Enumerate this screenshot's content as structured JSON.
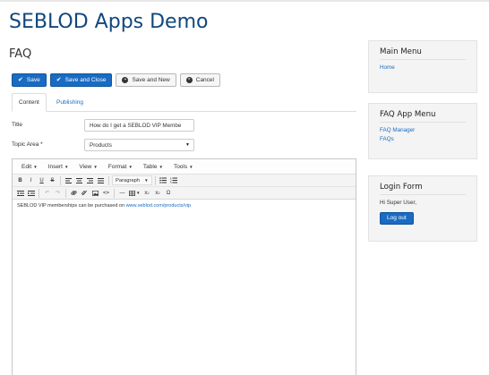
{
  "site": {
    "title": "SEBLOD Apps Demo"
  },
  "page": {
    "title": "FAQ"
  },
  "toolbar": {
    "save_label": "Save",
    "save_close_label": "Save and Close",
    "save_new_label": "Save and New",
    "cancel_label": "Cancel"
  },
  "tabs": [
    {
      "label": "Content",
      "active": true
    },
    {
      "label": "Publishing",
      "active": false
    }
  ],
  "form": {
    "title_label": "Title",
    "title_value": "How do I get a SEBLOD VIP Membe",
    "topic_label": "Topic Area *",
    "topic_value": "Products"
  },
  "editor": {
    "menus": [
      "Edit",
      "Insert",
      "View",
      "Format",
      "Table",
      "Tools"
    ],
    "paragraph_label": "Paragraph",
    "content_text": "SEBLOD VIP memberships can be purchased on ",
    "content_link": "www.seblod.com/products/vip"
  },
  "sidebar": {
    "main_menu": {
      "title": "Main Menu",
      "items": [
        "Home"
      ]
    },
    "faq_menu": {
      "title": "FAQ App Menu",
      "items": [
        "FAQ Manager",
        "FAQs"
      ]
    },
    "login": {
      "title": "Login Form",
      "greeting": "Hi Super User,",
      "logout_label": "Log out"
    }
  },
  "colors": {
    "brand": "#11477d",
    "primary": "#1a6bc2",
    "panel_bg": "#f4f4f4"
  }
}
